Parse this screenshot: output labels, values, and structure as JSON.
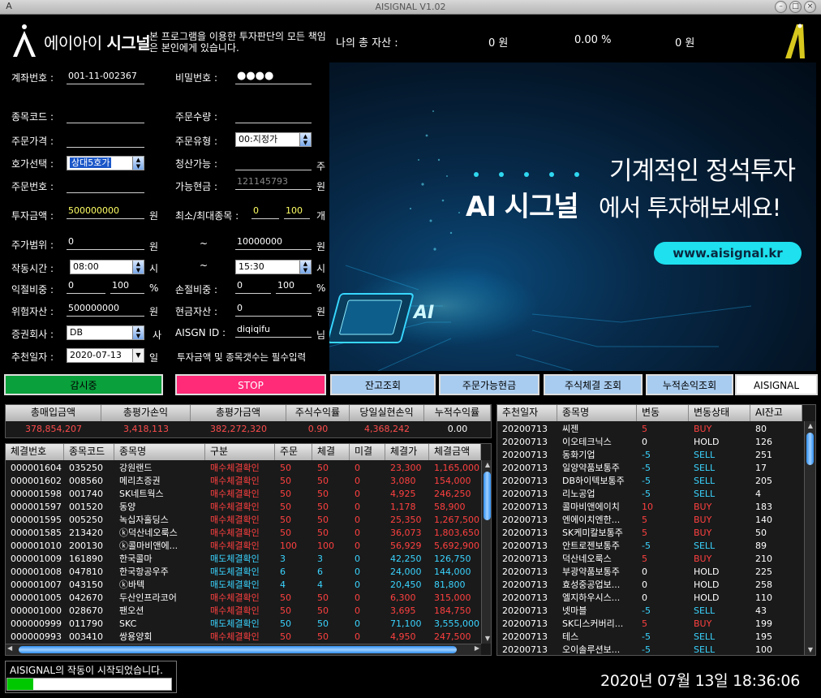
{
  "window": {
    "title": "AISIGNAL V1.02"
  },
  "header": {
    "logo_text_a": "에이아이 ",
    "logo_text_b": "시그널",
    "disclaimer": "본 프로그램을 이용한 투자판단의 모든 책임은 본인에게 있습니다.",
    "asset_label": "나의 총 자산 :",
    "asset_won": "0 원",
    "asset_percent": "0.00 %",
    "asset_won2": "0 원"
  },
  "form": {
    "account_label": "계좌번호 :",
    "account_value": "001-11-002367",
    "password_label": "비밀번호 :",
    "password_value": "●●●●",
    "stock_code_label": "종목코드 :",
    "stock_code_value": "",
    "order_qty_label": "주문수량 :",
    "order_qty_value": "",
    "order_price_label": "주문가격 :",
    "order_price_value": "",
    "order_type_label": "주문유형 :",
    "order_type_value": "00:지정가",
    "quote_label": "호가선택 :",
    "quote_value": "상대5호가",
    "settle_label": "청산가능 :",
    "settle_value": "",
    "settle_unit": "주",
    "order_no_label": "주문번호 :",
    "order_no_value": "",
    "avail_cash_label": "가능현금 :",
    "avail_cash_value": "121145793",
    "avail_cash_unit": "원",
    "invest_label": "투자금액 :",
    "invest_value": "500000000",
    "invest_unit": "원",
    "minmax_label": "최소/최대종목 :",
    "min_value": "0",
    "max_value": "100",
    "minmax_unit": "개",
    "price_range_label": "주가범위 :",
    "price_min": "0",
    "price_unit1": "원",
    "tilde1": "~",
    "price_max": "10000000",
    "price_unit2": "원",
    "time_label": "작동시간 :",
    "time_start": "08:00",
    "time_unit1": "시",
    "tilde2": "~",
    "time_end": "15:30",
    "time_unit2": "시",
    "profit_label": "익절비중 :",
    "profit_min": "0",
    "profit_max": "100",
    "profit_unit": "%",
    "loss_label": "손절비중 :",
    "loss_min": "0",
    "loss_max": "100",
    "loss_unit": "%",
    "risk_label": "위험자산 :",
    "risk_value": "500000000",
    "risk_unit": "원",
    "cash_label": "현금자산 :",
    "cash_value": "0",
    "cash_unit": "원",
    "broker_label": "증권회사 :",
    "broker_value": "DB",
    "broker_unit": "사",
    "aisgn_label": "AISGN ID :",
    "aisgn_value": "diqiqifu",
    "aisgn_unit": "님",
    "rec_date_label": "추천일자 :",
    "rec_date_value": "2020-07-13",
    "rec_date_unit": "일",
    "required_note": "투자금액 및 종목갯수는 필수입력"
  },
  "banner": {
    "line1": "기계적인 정석투자",
    "line2a": "AI 시그널",
    "line2b": "에서 투자해보세요!",
    "url": "www.aisignal.kr",
    "chip_text": "AI"
  },
  "buttons": {
    "monitoring": "감시중",
    "stop": "STOP",
    "balance": "잔고조회",
    "order_cash": "주문가능현금",
    "execution": "주식체결 조회",
    "cumulative": "누적손익조회",
    "aisignal": "AISIGNAL"
  },
  "summary": {
    "headers": [
      "총매입금액",
      "총평가손익",
      "총평가금액",
      "주식수익률",
      "당일실현손익",
      "누적수익률"
    ],
    "values": [
      "378,854,207",
      "3,418,113",
      "382,272,320",
      "0.90",
      "4,368,242",
      "0.00"
    ]
  },
  "exec_table": {
    "headers": [
      "체결번호",
      "종목코드",
      "종목명",
      "구분",
      "주문",
      "체결",
      "미결",
      "체결가",
      "체결금액"
    ],
    "rows": [
      [
        "000001604",
        "035250",
        "강원랜드",
        "매수체결확인",
        "50",
        "50",
        "0",
        "23,300",
        "1,165,000",
        "buy"
      ],
      [
        "000001602",
        "008560",
        "메리츠증권",
        "매수체결확인",
        "50",
        "50",
        "0",
        "3,080",
        "154,000",
        "buy"
      ],
      [
        "000001598",
        "001740",
        "SK네트웍스",
        "매수체결확인",
        "50",
        "50",
        "0",
        "4,925",
        "246,250",
        "buy"
      ],
      [
        "000001597",
        "001520",
        "동양",
        "매수체결확인",
        "50",
        "50",
        "0",
        "1,178",
        "58,900",
        "buy"
      ],
      [
        "000001595",
        "005250",
        "녹십자홀딩스",
        "매수체결확인",
        "50",
        "50",
        "0",
        "25,350",
        "1,267,500",
        "buy"
      ],
      [
        "000001585",
        "213420",
        "ⓚ덕산네오룩스",
        "매수체결확인",
        "50",
        "50",
        "0",
        "36,073",
        "1,803,650",
        "buy"
      ],
      [
        "000001010",
        "200130",
        "ⓚ콜마비앤에...",
        "매수체결확인",
        "100",
        "100",
        "0",
        "56,929",
        "5,692,900",
        "buy"
      ],
      [
        "000001009",
        "161890",
        "한국콜마",
        "매도체결확인",
        "3",
        "3",
        "0",
        "42,250",
        "126,750",
        "sell"
      ],
      [
        "000001008",
        "047810",
        "한국항공우주",
        "매도체결확인",
        "6",
        "6",
        "0",
        "24,000",
        "144,000",
        "sell"
      ],
      [
        "000001007",
        "043150",
        "ⓚ바텍",
        "매도체결확인",
        "4",
        "4",
        "0",
        "20,450",
        "81,800",
        "sell"
      ],
      [
        "000001005",
        "042670",
        "두산인프라코어",
        "매수체결확인",
        "50",
        "50",
        "0",
        "6,300",
        "315,000",
        "buy"
      ],
      [
        "000001000",
        "028670",
        "팬오션",
        "매수체결확인",
        "50",
        "50",
        "0",
        "3,695",
        "184,750",
        "buy"
      ],
      [
        "000000999",
        "011790",
        "SKC",
        "매도체결확인",
        "50",
        "50",
        "0",
        "71,100",
        "3,555,000",
        "sell"
      ],
      [
        "000000993",
        "003410",
        "쌍용양회",
        "매수체결확인",
        "50",
        "50",
        "0",
        "4,950",
        "247,500",
        "buy"
      ]
    ]
  },
  "rec_table": {
    "headers": [
      "추천일자",
      "종목명",
      "변동",
      "변동상태",
      "AI잔고"
    ],
    "rows": [
      [
        "20200713",
        "씨젠",
        "5",
        "BUY",
        "80"
      ],
      [
        "20200713",
        "이오테크닉스",
        "0",
        "HOLD",
        "126"
      ],
      [
        "20200713",
        "동화기업",
        "-5",
        "SELL",
        "251"
      ],
      [
        "20200713",
        "일양약품보통주",
        "-5",
        "SELL",
        "17"
      ],
      [
        "20200713",
        "DB하이텍보통주",
        "-5",
        "SELL",
        "205"
      ],
      [
        "20200713",
        "리노공업",
        "-5",
        "SELL",
        "4"
      ],
      [
        "20200713",
        "콜마비앤에이치",
        "10",
        "BUY",
        "183"
      ],
      [
        "20200713",
        "엔에이치엔한...",
        "5",
        "BUY",
        "140"
      ],
      [
        "20200713",
        "SK케미칼보통주",
        "5",
        "BUY",
        "50"
      ],
      [
        "20200713",
        "안트로젠보통주",
        "-5",
        "SELL",
        "89"
      ],
      [
        "20200713",
        "덕산네오룩스",
        "5",
        "BUY",
        "210"
      ],
      [
        "20200713",
        "부광약품보통주",
        "0",
        "HOLD",
        "225"
      ],
      [
        "20200713",
        "효성중공업보...",
        "0",
        "HOLD",
        "258"
      ],
      [
        "20200713",
        "엘지하우시스...",
        "0",
        "HOLD",
        "110"
      ],
      [
        "20200713",
        "넷마블",
        "-5",
        "SELL",
        "43"
      ],
      [
        "20200713",
        "SK디스커버리...",
        "5",
        "BUY",
        "199"
      ],
      [
        "20200713",
        "테스",
        "-5",
        "SELL",
        "195"
      ],
      [
        "20200713",
        "오이솔루션보...",
        "-5",
        "SELL",
        "100"
      ]
    ]
  },
  "status": {
    "message": "AISIGNAL의 작동이 시작되었습니다.",
    "progress_fraction": 0.16,
    "clock": "2020년 07월 13일 18:36:06"
  },
  "colors": {
    "buy": "#ff4040",
    "sell": "#3ad4ff",
    "hold": "#ffffff",
    "accent": "#1ee0ee"
  }
}
